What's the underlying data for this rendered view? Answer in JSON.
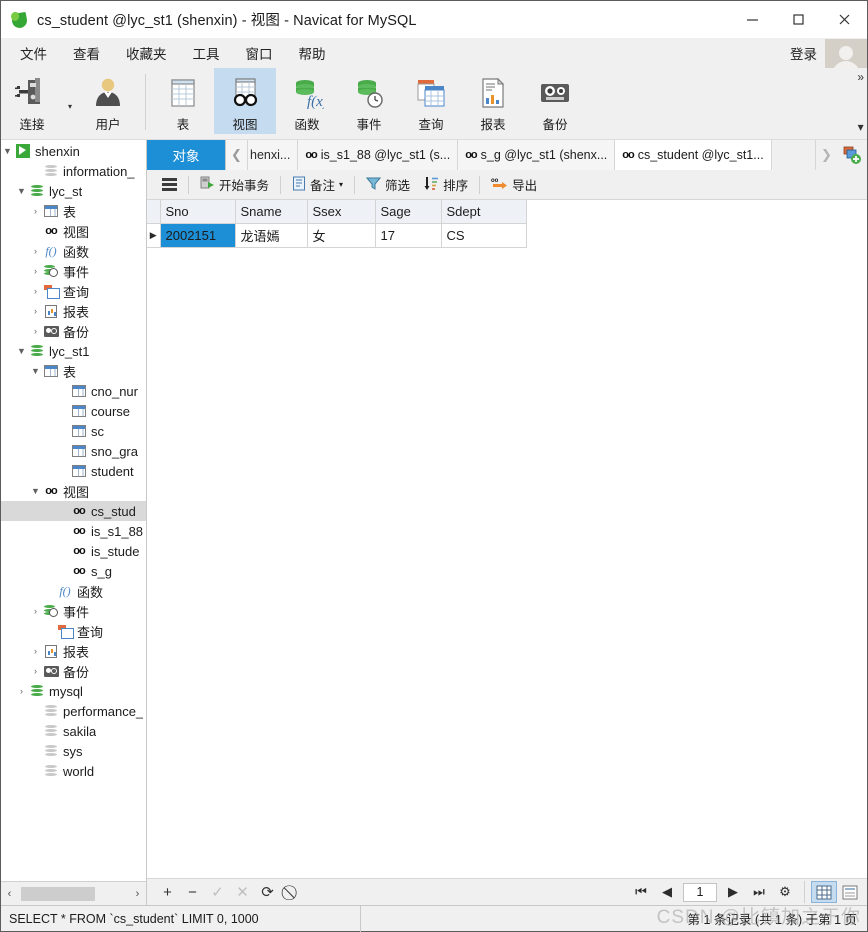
{
  "window": {
    "title": "cs_student @lyc_st1 (shenxin) - 视图 - Navicat for MySQL",
    "app_icon": "navicat-leaf-icon",
    "minimize": "−",
    "maximize": "□",
    "close": "✕"
  },
  "menubar": {
    "items": [
      {
        "label": "文件",
        "name": "menu-file"
      },
      {
        "label": "查看",
        "name": "menu-view"
      },
      {
        "label": "收藏夹",
        "name": "menu-favorites"
      },
      {
        "label": "工具",
        "name": "menu-tools"
      },
      {
        "label": "窗口",
        "name": "menu-window"
      },
      {
        "label": "帮助",
        "name": "menu-help"
      }
    ],
    "login_label": "登录"
  },
  "toolbar": {
    "buttons": [
      {
        "label": "连接",
        "icon": "connection-icon",
        "active": false,
        "has_caret": true
      },
      {
        "label": "用户",
        "icon": "user-icon",
        "active": false,
        "has_caret": false
      },
      {
        "label": "表",
        "icon": "table-icon",
        "active": false,
        "has_caret": false
      },
      {
        "label": "视图",
        "icon": "view-glasses-icon",
        "active": true,
        "has_caret": false
      },
      {
        "label": "函数",
        "icon": "function-icon",
        "active": false,
        "has_caret": false
      },
      {
        "label": "事件",
        "icon": "event-clock-icon",
        "active": false,
        "has_caret": false
      },
      {
        "label": "查询",
        "icon": "query-icon",
        "active": false,
        "has_caret": false
      },
      {
        "label": "报表",
        "icon": "report-icon",
        "active": false,
        "has_caret": false
      },
      {
        "label": "备份",
        "icon": "backup-icon",
        "active": false,
        "has_caret": false
      }
    ],
    "overflow_top": "»",
    "overflow_bottom": "▾"
  },
  "sidebar": {
    "tree": [
      {
        "label": "shenxin",
        "indent": 0,
        "icon": "connection-icon",
        "arrow": "▼",
        "selected": false
      },
      {
        "label": "information_",
        "indent": 2,
        "icon": "database-gray-icon",
        "arrow": "",
        "selected": false
      },
      {
        "label": "lyc_st",
        "indent": 1,
        "icon": "database-icon",
        "arrow": "▼",
        "selected": false
      },
      {
        "label": "表",
        "indent": 2,
        "icon": "table-icon",
        "arrow": "›",
        "selected": false
      },
      {
        "label": "视图",
        "indent": 2,
        "icon": "view-icon",
        "arrow": "",
        "selected": false
      },
      {
        "label": "函数",
        "indent": 2,
        "icon": "function-icon",
        "arrow": "›",
        "selected": false
      },
      {
        "label": "事件",
        "indent": 2,
        "icon": "event-icon",
        "arrow": "›",
        "selected": false
      },
      {
        "label": "查询",
        "indent": 2,
        "icon": "query-icon",
        "arrow": "›",
        "selected": false
      },
      {
        "label": "报表",
        "indent": 2,
        "icon": "report-icon",
        "arrow": "›",
        "selected": false
      },
      {
        "label": "备份",
        "indent": 2,
        "icon": "backup-icon",
        "arrow": "›",
        "selected": false
      },
      {
        "label": "lyc_st1",
        "indent": 1,
        "icon": "database-icon",
        "arrow": "▼",
        "selected": false
      },
      {
        "label": "表",
        "indent": 2,
        "icon": "table-icon",
        "arrow": "▼",
        "selected": false
      },
      {
        "label": "cno_nur",
        "indent": 4,
        "icon": "table-icon",
        "arrow": "",
        "selected": false
      },
      {
        "label": "course",
        "indent": 4,
        "icon": "table-icon",
        "arrow": "",
        "selected": false
      },
      {
        "label": "sc",
        "indent": 4,
        "icon": "table-icon",
        "arrow": "",
        "selected": false
      },
      {
        "label": "sno_gra",
        "indent": 4,
        "icon": "table-icon",
        "arrow": "",
        "selected": false
      },
      {
        "label": "student",
        "indent": 4,
        "icon": "table-icon",
        "arrow": "",
        "selected": false
      },
      {
        "label": "视图",
        "indent": 2,
        "icon": "view-icon",
        "arrow": "▼",
        "selected": false
      },
      {
        "label": "cs_stud",
        "indent": 4,
        "icon": "view-icon",
        "arrow": "",
        "selected": true
      },
      {
        "label": "is_s1_88",
        "indent": 4,
        "icon": "view-icon",
        "arrow": "",
        "selected": false
      },
      {
        "label": "is_stude",
        "indent": 4,
        "icon": "view-icon",
        "arrow": "",
        "selected": false
      },
      {
        "label": "s_g",
        "indent": 4,
        "icon": "view-icon",
        "arrow": "",
        "selected": false
      },
      {
        "label": "函数",
        "indent": 3,
        "icon": "function-icon",
        "arrow": "",
        "selected": false
      },
      {
        "label": "事件",
        "indent": 2,
        "icon": "event-icon",
        "arrow": "›",
        "selected": false
      },
      {
        "label": "查询",
        "indent": 3,
        "icon": "query-icon",
        "arrow": "",
        "selected": false
      },
      {
        "label": "报表",
        "indent": 2,
        "icon": "report-icon",
        "arrow": "›",
        "selected": false
      },
      {
        "label": "备份",
        "indent": 2,
        "icon": "backup-icon",
        "arrow": "›",
        "selected": false
      },
      {
        "label": "mysql",
        "indent": 1,
        "icon": "database-icon",
        "arrow": "›",
        "selected": false
      },
      {
        "label": "performance_",
        "indent": 2,
        "icon": "database-gray-icon",
        "arrow": "",
        "selected": false
      },
      {
        "label": "sakila",
        "indent": 2,
        "icon": "database-gray-icon",
        "arrow": "",
        "selected": false
      },
      {
        "label": "sys",
        "indent": 2,
        "icon": "database-gray-icon",
        "arrow": "",
        "selected": false
      },
      {
        "label": "world",
        "indent": 2,
        "icon": "database-gray-icon",
        "arrow": "",
        "selected": false
      }
    ],
    "scroll_left": "‹",
    "scroll_right": "›"
  },
  "tabbar": {
    "object_tab": "对象",
    "nav_left": "❮",
    "nav_right": "❯",
    "tabs": [
      {
        "label": "henxi...",
        "icon": "",
        "active": false,
        "partial": true
      },
      {
        "label": "is_s1_88 @lyc_st1 (s...",
        "icon": "view-icon",
        "active": false,
        "partial": false
      },
      {
        "label": "s_g @lyc_st1 (shenx...",
        "icon": "view-icon",
        "active": false,
        "partial": false
      },
      {
        "label": "cs_student @lyc_st1...",
        "icon": "view-icon",
        "active": true,
        "partial": false
      }
    ],
    "add_tab_icon": "add-tab-icon"
  },
  "datatoolbar": {
    "menu_icon": "hamburger-icon",
    "buttons": [
      {
        "label": "开始事务",
        "icon": "begin-transaction-icon",
        "caret": false
      },
      {
        "label": "备注",
        "icon": "note-icon",
        "caret": true
      },
      {
        "label": "筛选",
        "icon": "filter-icon",
        "caret": false
      },
      {
        "label": "排序",
        "icon": "sort-icon",
        "caret": false
      },
      {
        "label": "导出",
        "icon": "export-icon",
        "caret": false
      }
    ]
  },
  "grid": {
    "columns": [
      "Sno",
      "Sname",
      "Ssex",
      "Sage",
      "Sdept"
    ],
    "rows": [
      {
        "marker": "▶",
        "cells": [
          "2002151",
          "龙语嫣",
          "女",
          "17",
          "CS"
        ],
        "selected_col": 0
      }
    ],
    "numeric_columns": [
      3
    ]
  },
  "editbar": {
    "add": "+",
    "remove": "−",
    "confirm": "✓",
    "cancel": "✕",
    "refresh": "⟳",
    "stop": "⃠",
    "first_page": "⏮",
    "prev_page": "◀",
    "page_value": "1",
    "next_page": "▶",
    "last_page": "⏭",
    "settings": "⚙",
    "grid_view_icon": "grid-view-icon",
    "form_view_icon": "form-view-icon"
  },
  "statusbar": {
    "sql": "SELECT * FROM `cs_student` LIMIT 0, 1000",
    "record_info": "第 1 条记录 (共 1 条) 于第 1 页"
  },
  "watermark": "CSDN @比镇加之于你",
  "colors": {
    "accent_blue": "#1d8fd6",
    "toolbar_active": "#c5dcf0",
    "tree_selected": "#d9d9d9",
    "chrome_bg": "#f0f0f0"
  }
}
